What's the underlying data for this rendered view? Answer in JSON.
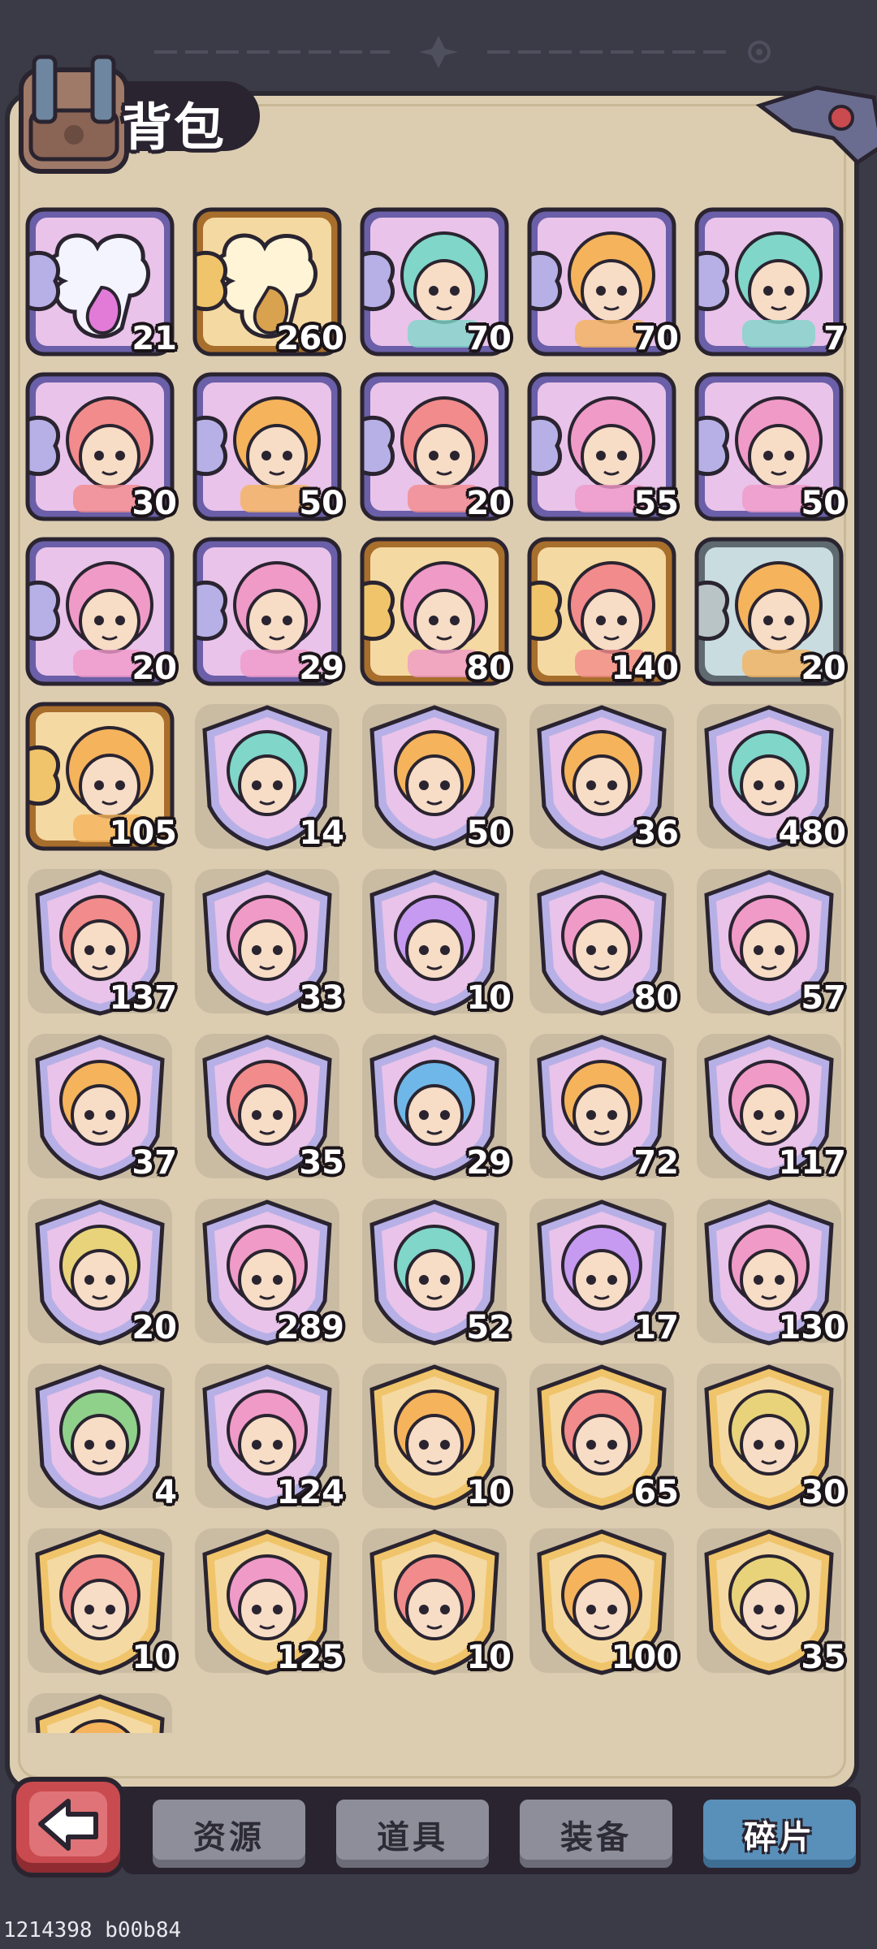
{
  "header": {
    "title": "背包",
    "icon": "backpack-icon"
  },
  "colors": {
    "background": "#3a3b47",
    "panel": "#dccdb1",
    "outline": "#2a2430",
    "tab_active": "#5990b9",
    "tab_inactive": "#8e8e9a",
    "back_button": "#c94a4f"
  },
  "items": [
    {
      "kind": "puzzle-item",
      "frame": "purple",
      "art": "purple-fragment",
      "count": "21"
    },
    {
      "kind": "puzzle-item",
      "frame": "gold",
      "art": "gold-fragment",
      "count": "260"
    },
    {
      "kind": "puzzle-hero",
      "frame": "purple",
      "art": "red-haired-heroine",
      "count": "70"
    },
    {
      "kind": "puzzle-hero",
      "frame": "purple",
      "art": "tiger-hero",
      "count": "70"
    },
    {
      "kind": "puzzle-hero",
      "frame": "purple",
      "art": "bull-hero",
      "count": "7"
    },
    {
      "kind": "puzzle-hero",
      "frame": "purple",
      "art": "green-elf-heroine",
      "count": "30"
    },
    {
      "kind": "puzzle-hero",
      "frame": "purple",
      "art": "teal-priestess",
      "count": "50"
    },
    {
      "kind": "puzzle-hero",
      "frame": "purple",
      "art": "masked-fire-hero",
      "count": "20"
    },
    {
      "kind": "puzzle-hero",
      "frame": "purple",
      "art": "goggles-warrior",
      "count": "55"
    },
    {
      "kind": "puzzle-hero",
      "frame": "purple",
      "art": "blonde-heroine",
      "count": "50"
    },
    {
      "kind": "puzzle-hero",
      "frame": "purple",
      "art": "blue-elf-archer",
      "count": "20"
    },
    {
      "kind": "puzzle-hero",
      "frame": "purple",
      "art": "blue-haired-mage",
      "count": "29"
    },
    {
      "kind": "puzzle-hero",
      "frame": "gold",
      "art": "dreadlock-warrior",
      "count": "80"
    },
    {
      "kind": "puzzle-hero",
      "frame": "gold",
      "art": "pink-engineer",
      "count": "140"
    },
    {
      "kind": "puzzle-hero",
      "frame": "silver",
      "art": "bearded-warrior",
      "count": "20"
    },
    {
      "kind": "puzzle-hero",
      "frame": "gold",
      "art": "desert-lady",
      "count": "105"
    },
    {
      "kind": "shield-hero",
      "frame": "purple",
      "art": "red-haired-heroine",
      "count": "14"
    },
    {
      "kind": "shield-hero",
      "frame": "purple",
      "art": "tiger-hero",
      "count": "50"
    },
    {
      "kind": "shield-hero",
      "frame": "purple",
      "art": "blonde-knight",
      "count": "36"
    },
    {
      "kind": "shield-hero",
      "frame": "purple",
      "art": "bull-hero",
      "count": "480"
    },
    {
      "kind": "shield-hero",
      "frame": "purple",
      "art": "green-elf-heroine",
      "count": "137"
    },
    {
      "kind": "shield-hero",
      "frame": "purple",
      "art": "golden-crown-hero",
      "count": "33"
    },
    {
      "kind": "shield-hero",
      "frame": "purple",
      "art": "blue-haired-boy",
      "count": "10"
    },
    {
      "kind": "shield-hero",
      "frame": "purple",
      "art": "red-bandana-warrior",
      "count": "80"
    },
    {
      "kind": "shield-hero",
      "frame": "purple",
      "art": "green-haired-elf",
      "count": "57"
    },
    {
      "kind": "shield-hero",
      "frame": "purple",
      "art": "teal-priestess",
      "count": "37"
    },
    {
      "kind": "shield-hero",
      "frame": "purple",
      "art": "masked-fire-hero",
      "count": "35"
    },
    {
      "kind": "shield-hero",
      "frame": "purple",
      "art": "purple-haired-mage",
      "count": "29"
    },
    {
      "kind": "shield-hero",
      "frame": "purple",
      "art": "shark-hero",
      "count": "72"
    },
    {
      "kind": "shield-hero",
      "frame": "purple",
      "art": "goggles-warrior",
      "count": "117"
    },
    {
      "kind": "shield-hero",
      "frame": "purple",
      "art": "green-orc",
      "count": "20"
    },
    {
      "kind": "shield-hero",
      "frame": "purple",
      "art": "blue-haired-mage",
      "count": "289"
    },
    {
      "kind": "shield-hero",
      "frame": "purple",
      "art": "goggles-boy",
      "count": "52"
    },
    {
      "kind": "shield-hero",
      "frame": "purple",
      "art": "white-elder",
      "count": "17"
    },
    {
      "kind": "shield-hero",
      "frame": "purple",
      "art": "blonde-heroine",
      "count": "130"
    },
    {
      "kind": "shield-hero",
      "frame": "purple",
      "art": "white-haired-girl",
      "count": "4"
    },
    {
      "kind": "shield-hero",
      "frame": "purple",
      "art": "blue-elf-archer",
      "count": "124"
    },
    {
      "kind": "shield-hero",
      "frame": "gold",
      "art": "red-braided-lady",
      "count": "10"
    },
    {
      "kind": "shield-hero",
      "frame": "gold",
      "art": "orange-haired-girl",
      "count": "65"
    },
    {
      "kind": "shield-hero",
      "frame": "gold",
      "art": "masked-golem",
      "count": "30"
    },
    {
      "kind": "shield-hero",
      "frame": "gold",
      "art": "green-haired-man",
      "count": "10"
    },
    {
      "kind": "shield-hero",
      "frame": "gold",
      "art": "dreadlock-warrior",
      "count": "125"
    },
    {
      "kind": "shield-hero",
      "frame": "gold",
      "art": "pink-engineer",
      "count": "10"
    },
    {
      "kind": "shield-hero",
      "frame": "gold",
      "art": "silver-haired-elf",
      "count": "100"
    },
    {
      "kind": "shield-hero",
      "frame": "gold",
      "art": "golden-lion-warrior",
      "count": "35"
    },
    {
      "kind": "shield-hero",
      "frame": "gold",
      "art": "desert-lady",
      "count": ""
    }
  ],
  "tabs": [
    {
      "label": "资源",
      "active": false
    },
    {
      "label": "道具",
      "active": false
    },
    {
      "label": "装备",
      "active": false
    },
    {
      "label": "碎片",
      "active": true
    }
  ],
  "back_button": {
    "icon": "back-arrow-icon"
  },
  "footer": {
    "text": "1214398 b00b84"
  }
}
